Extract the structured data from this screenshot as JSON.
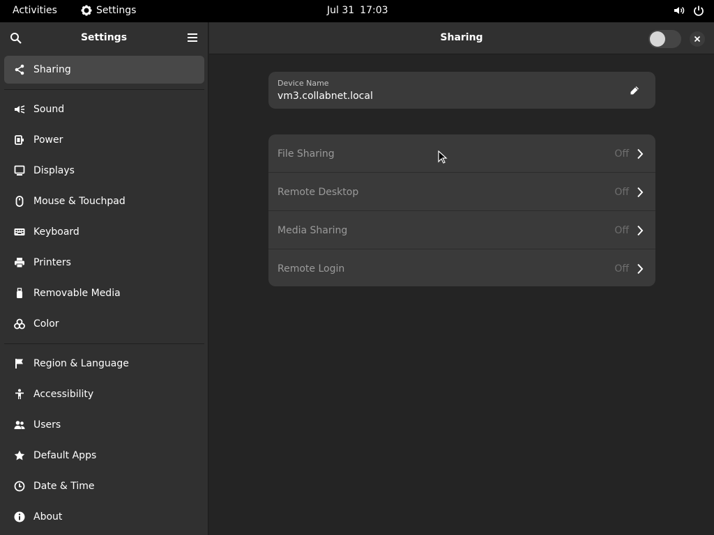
{
  "topbar": {
    "activities": "Activities",
    "app_name": "Settings",
    "date": "Jul 31",
    "time": "17:03"
  },
  "sidebar": {
    "title": "Settings",
    "items": [
      {
        "label": "Sharing",
        "icon": "share-icon",
        "active": true
      },
      {
        "label": "Sound",
        "icon": "speaker-icon"
      },
      {
        "label": "Power",
        "icon": "power-plug-icon"
      },
      {
        "label": "Displays",
        "icon": "display-icon"
      },
      {
        "label": "Mouse & Touchpad",
        "icon": "mouse-icon"
      },
      {
        "label": "Keyboard",
        "icon": "keyboard-icon"
      },
      {
        "label": "Printers",
        "icon": "printer-icon"
      },
      {
        "label": "Removable Media",
        "icon": "usb-drive-icon"
      },
      {
        "label": "Color",
        "icon": "color-icon"
      },
      {
        "label": "Region & Language",
        "icon": "flag-icon"
      },
      {
        "label": "Accessibility",
        "icon": "accessibility-icon"
      },
      {
        "label": "Users",
        "icon": "users-icon"
      },
      {
        "label": "Default Apps",
        "icon": "star-icon"
      },
      {
        "label": "Date & Time",
        "icon": "clock-icon"
      },
      {
        "label": "About",
        "icon": "info-icon"
      }
    ]
  },
  "main": {
    "title": "Sharing",
    "sharing_enabled": false,
    "device_name": {
      "label": "Device Name",
      "value": "vm3.collabnet.local"
    },
    "rows": [
      {
        "label": "File Sharing",
        "state": "Off"
      },
      {
        "label": "Remote Desktop",
        "state": "Off"
      },
      {
        "label": "Media Sharing",
        "state": "Off"
      },
      {
        "label": "Remote Login",
        "state": "Off"
      }
    ]
  },
  "colors": {
    "topbar_bg": "#000000",
    "sidebar_bg": "#303030",
    "content_bg": "#242424",
    "card_bg": "#3a3a3a",
    "active_item_bg": "#484848"
  }
}
